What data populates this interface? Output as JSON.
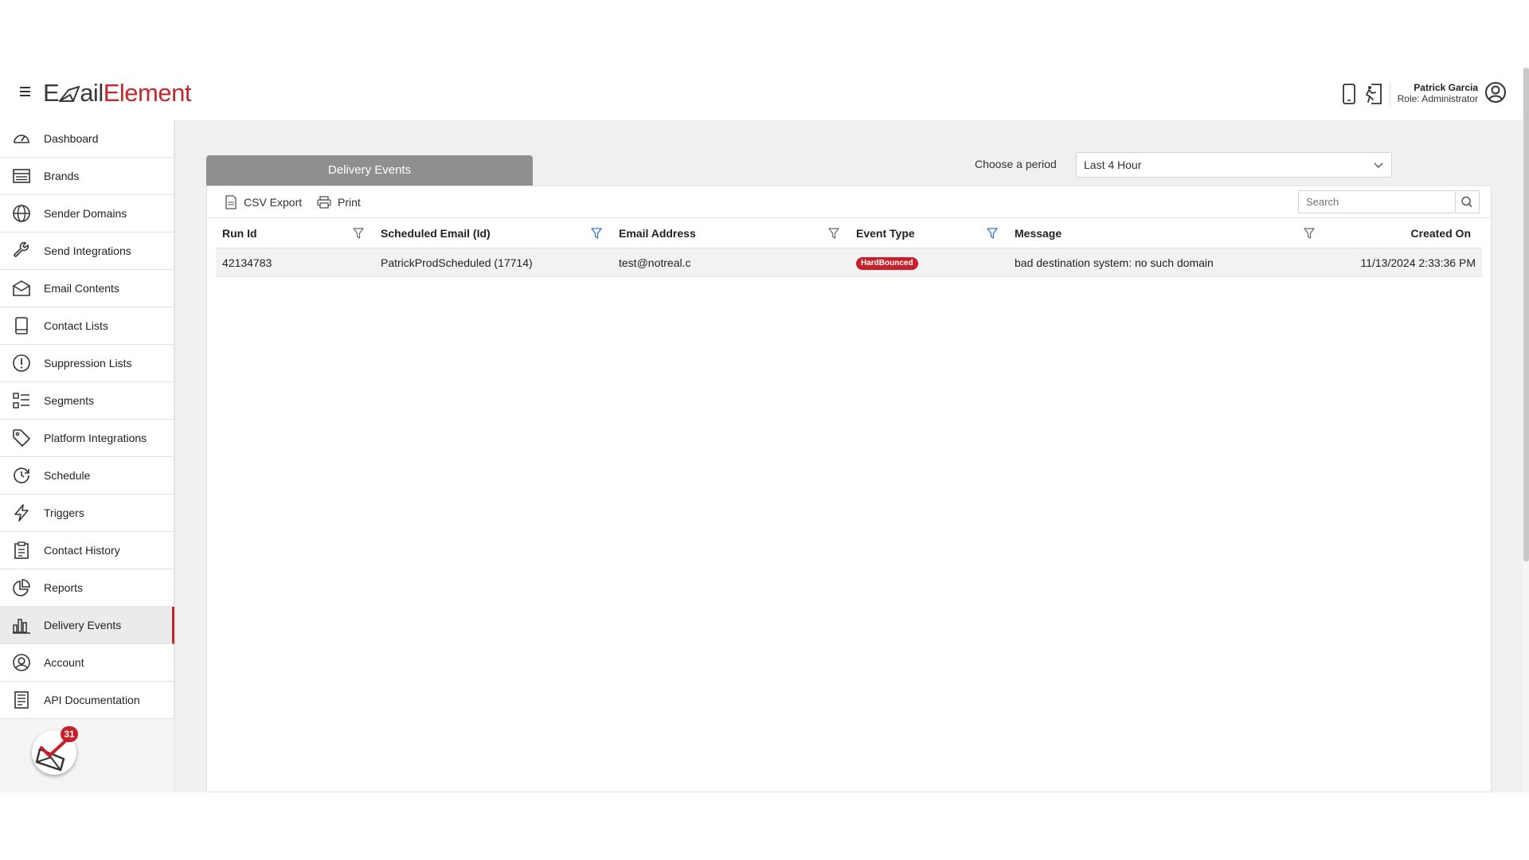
{
  "header": {
    "logo_part1": "EmailElement",
    "logo_a": "E",
    "logo_b": "ail",
    "logo_c": "Element",
    "user_name": "Patrick Garcia",
    "user_role": "Role: Administrator"
  },
  "sidebar": {
    "items": [
      {
        "label": "Dashboard",
        "icon": "dashboard-gauge-icon"
      },
      {
        "label": "Brands",
        "icon": "brands-list-icon"
      },
      {
        "label": "Sender Domains",
        "icon": "globe-icon"
      },
      {
        "label": "Send Integrations",
        "icon": "wrench-icon"
      },
      {
        "label": "Email Contents",
        "icon": "envelope-icon"
      },
      {
        "label": "Contact Lists",
        "icon": "book-icon"
      },
      {
        "label": "Suppression Lists",
        "icon": "exclamation-circle-icon"
      },
      {
        "label": "Segments",
        "icon": "segments-list-icon"
      },
      {
        "label": "Platform Integrations",
        "icon": "tag-icon"
      },
      {
        "label": "Schedule",
        "icon": "clock-history-icon"
      },
      {
        "label": "Triggers",
        "icon": "lightning-icon"
      },
      {
        "label": "Contact History",
        "icon": "clipboard-icon"
      },
      {
        "label": "Reports",
        "icon": "pie-chart-icon"
      },
      {
        "label": "Delivery Events",
        "icon": "bar-chart-icon"
      },
      {
        "label": "Account",
        "icon": "user-circle-icon"
      },
      {
        "label": "API Documentation",
        "icon": "document-icon"
      }
    ],
    "active": "Delivery Events",
    "notification_count": "31",
    "accent_color": "#c3282e"
  },
  "main": {
    "tab_label": "Delivery Events",
    "period_label": "Choose a period",
    "period_value": "Last 4 Hour",
    "toolbar": {
      "csv_export": "CSV Export",
      "print": "Print",
      "search_placeholder": "Search"
    },
    "table": {
      "columns": [
        "Run Id",
        "Scheduled Email (Id)",
        "Email Address",
        "Event Type",
        "Message",
        "Created On"
      ],
      "rows": [
        {
          "run_id": "42134783",
          "scheduled_email": "PatrickProdScheduled (17714)",
          "email_address": "test@notreal.c",
          "event_type": "HardBounced",
          "message": "bad destination system: no such domain",
          "created_on": "11/13/2024 2:33:36 PM"
        }
      ]
    },
    "badge_color": "#c8202a"
  }
}
